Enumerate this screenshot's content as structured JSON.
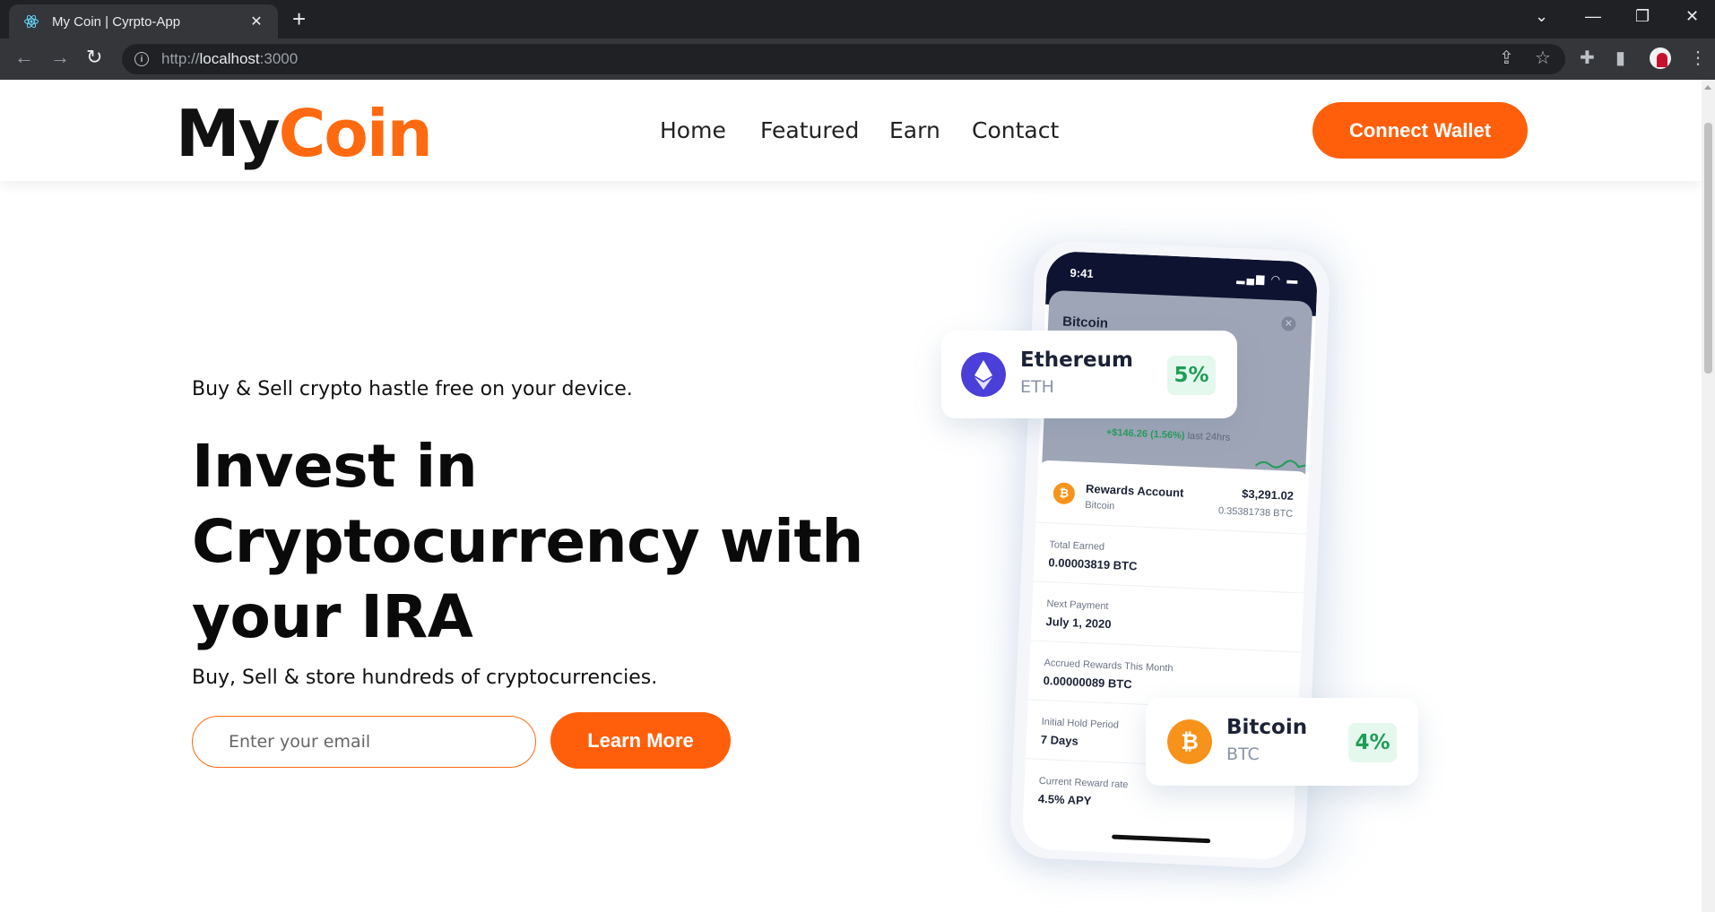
{
  "browser": {
    "tab_title": "My Coin | Cyrpto-App",
    "url_scheme": "http://",
    "url_host": "localhost",
    "url_port": ":3000"
  },
  "header": {
    "logo_part1": "My",
    "logo_part2": "Coin",
    "nav": [
      "Home",
      "Featured",
      "Earn",
      "Contact"
    ],
    "cta": "Connect Wallet"
  },
  "hero": {
    "tagline": "Buy & Sell crypto hastle free on your device.",
    "title_line1": "Invest in",
    "title_line2": "Cryptocurrency with",
    "title_line3": "your IRA",
    "subline": "Buy, Sell & store hundreds of cryptocurrencies.",
    "email_placeholder": "Enter your email",
    "button": "Learn More"
  },
  "phone": {
    "time": "9:41",
    "card_title": "Bitcoin",
    "change": "+$146.26 (1.56%)",
    "change_period": "last 24hrs",
    "account": {
      "name": "Rewards Account",
      "sub": "Bitcoin",
      "amount": "$3,291.02",
      "btc": "0.35381738 BTC"
    },
    "rows": [
      {
        "label": "Total Earned",
        "value": "0.00003819 BTC"
      },
      {
        "label": "Next Payment",
        "value": "July 1, 2020"
      },
      {
        "label": "Accrued Rewards This Month",
        "value": "0.00000089 BTC"
      },
      {
        "label": "Initial Hold Period",
        "value": "7 Days"
      },
      {
        "label": "Current Reward rate",
        "value": "4.5% APY"
      }
    ]
  },
  "coins": [
    {
      "name": "Ethereum",
      "ticker": "ETH",
      "percent": "5%",
      "color": "#4a3fd9",
      "icon": "ethereum-icon"
    },
    {
      "name": "Bitcoin",
      "ticker": "BTC",
      "percent": "4%",
      "color": "#f7931a",
      "icon": "bitcoin-icon"
    }
  ],
  "colors": {
    "accent": "#ff5f0b",
    "positive": "#1f9d55",
    "dark_navy": "#0d1330"
  }
}
